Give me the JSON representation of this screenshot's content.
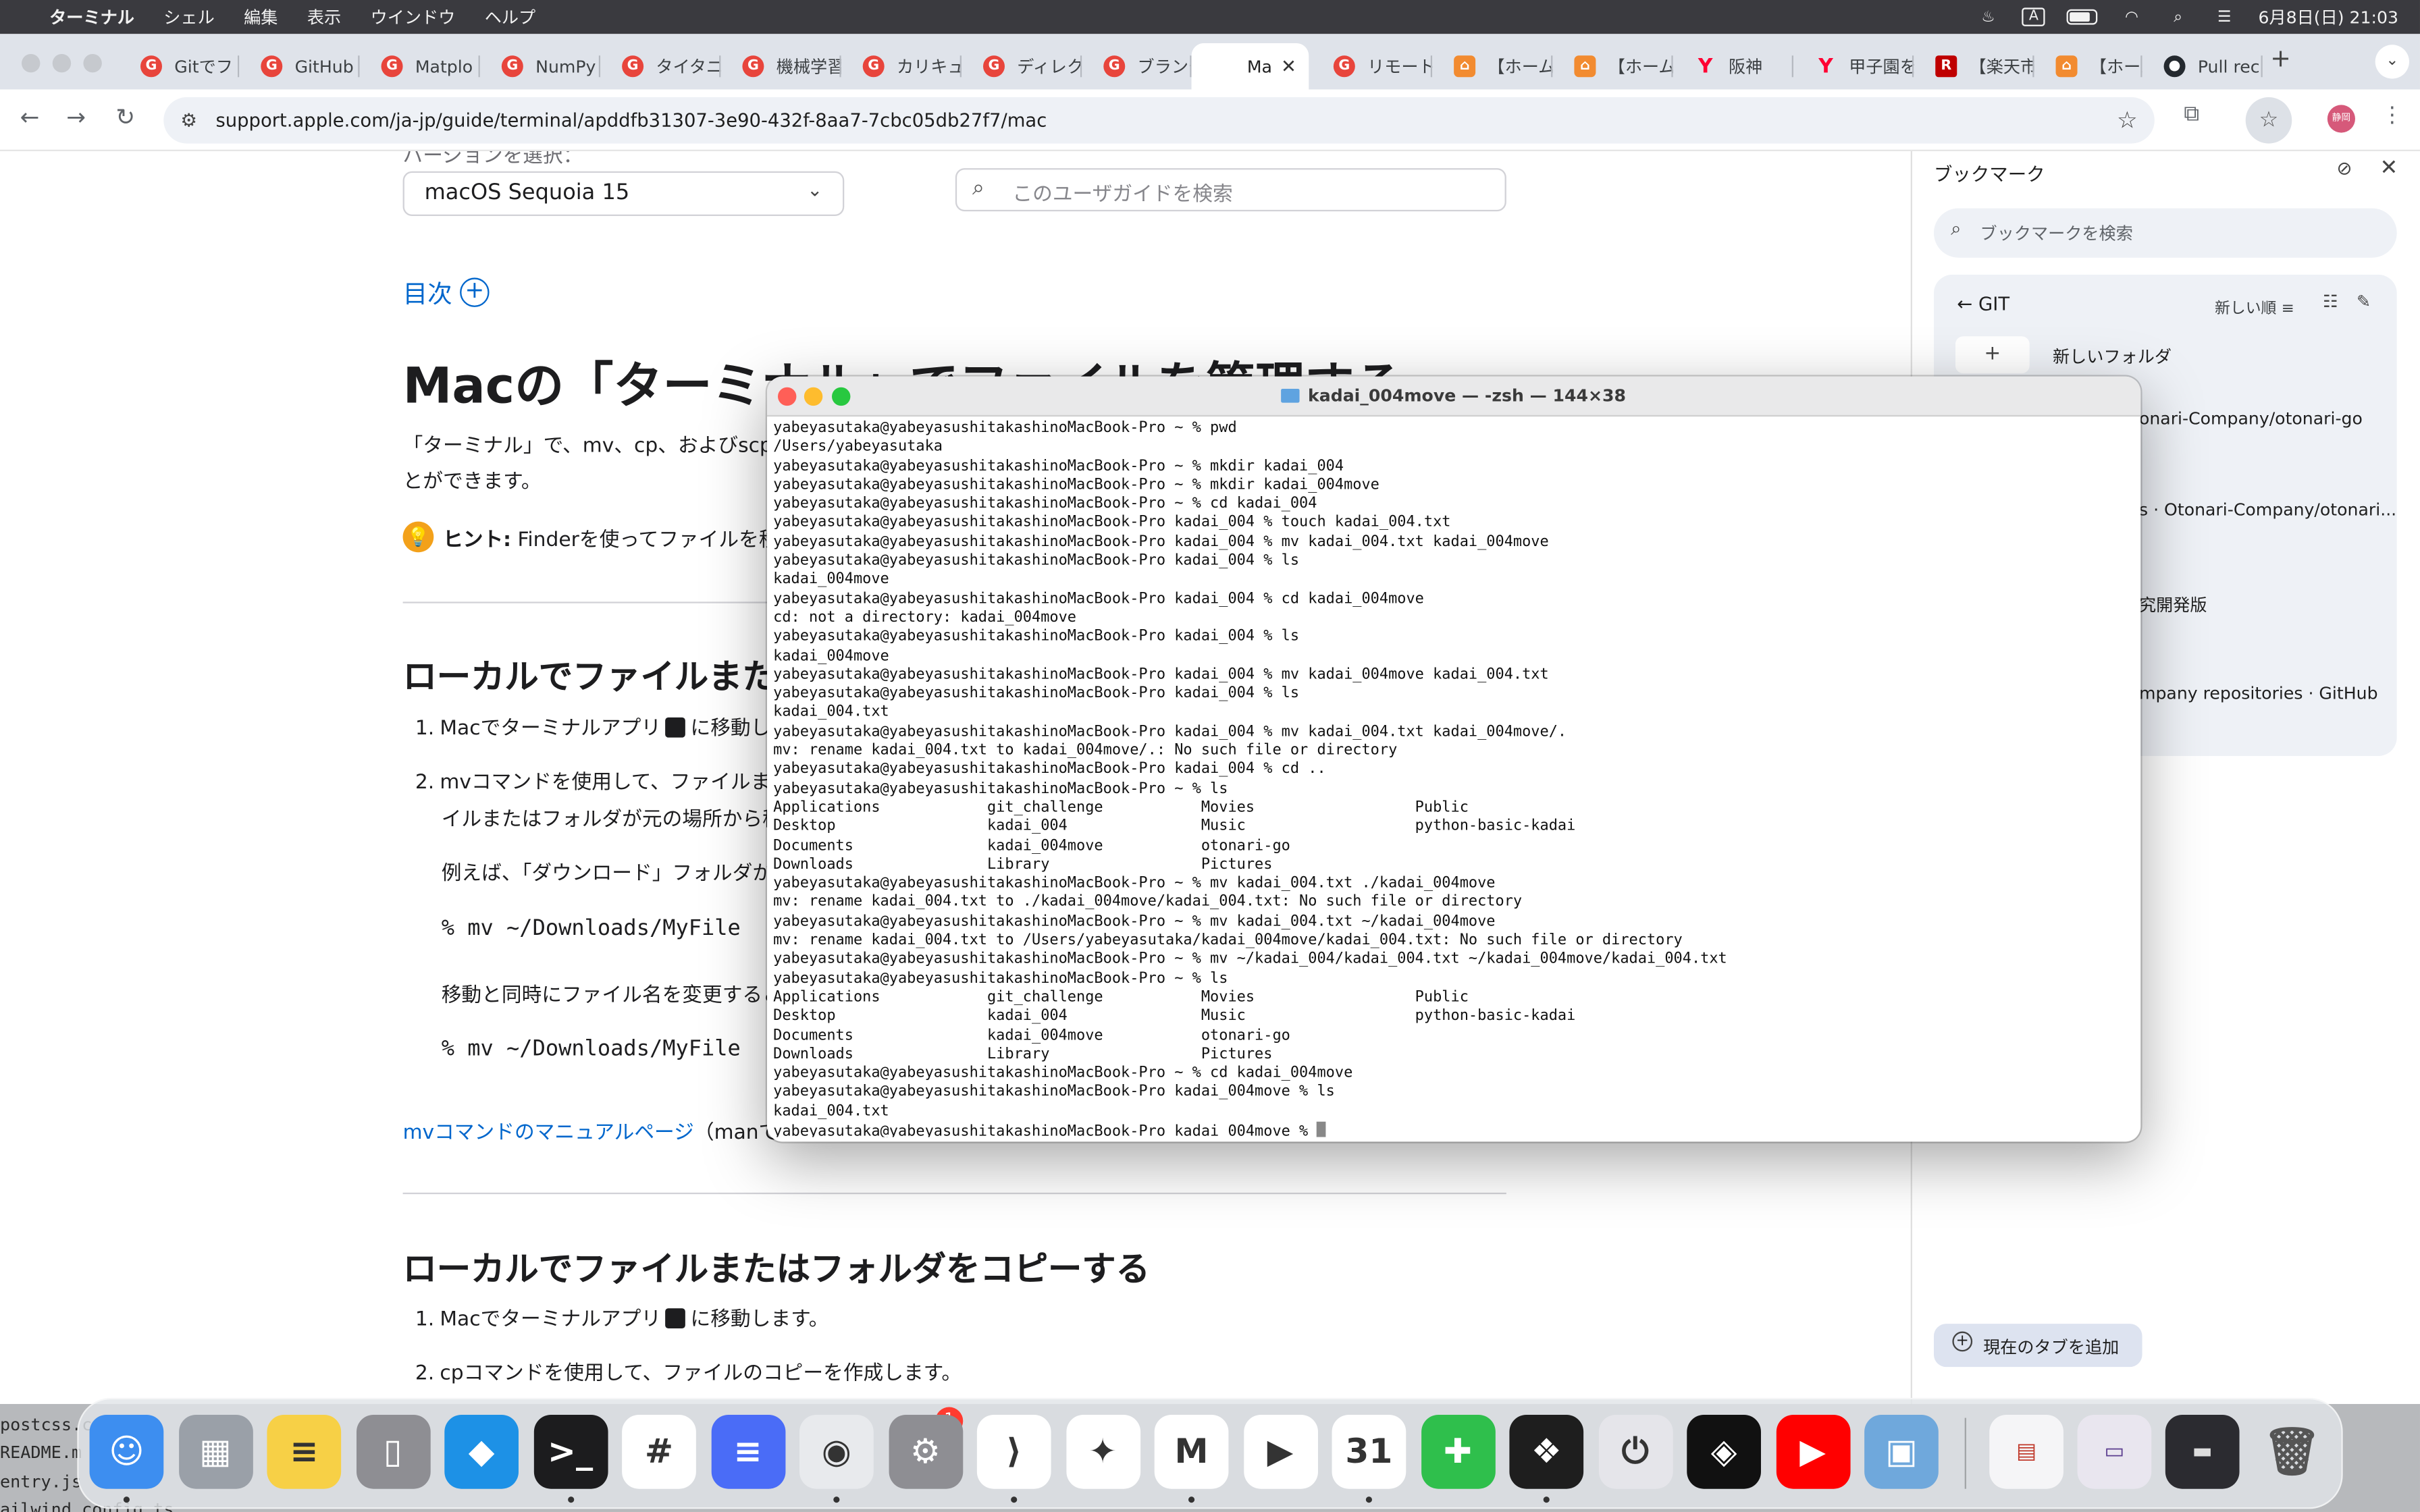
{
  "menubar": {
    "app_name": "ターミナル",
    "items": [
      "シェル",
      "編集",
      "表示",
      "ウインドウ",
      "ヘルプ"
    ],
    "input_indicator": "A",
    "clock": "6月8日(日) 21:03"
  },
  "tabs": [
    {
      "label": "Gitでフ",
      "icon": "red"
    },
    {
      "label": "GitHub",
      "icon": "red"
    },
    {
      "label": "Matplo",
      "icon": "red"
    },
    {
      "label": "NumPy",
      "icon": "red"
    },
    {
      "label": "タイタニ",
      "icon": "red"
    },
    {
      "label": "機械学習",
      "icon": "red"
    },
    {
      "label": "カリキュ",
      "icon": "red"
    },
    {
      "label": "ディレク",
      "icon": "red"
    },
    {
      "label": "ブランチ",
      "icon": "red"
    },
    {
      "label": "Ma",
      "icon": "apple",
      "active": true
    },
    {
      "label": "リモート",
      "icon": "red"
    },
    {
      "label": "【ホーム",
      "icon": "orange"
    },
    {
      "label": "【ホーム",
      "icon": "orange"
    },
    {
      "label": "阪神",
      "icon": "yahoo"
    },
    {
      "label": "甲子園を",
      "icon": "yahoo"
    },
    {
      "label": "【楽天市",
      "icon": "rakuten"
    },
    {
      "label": "【ホーム",
      "icon": "orange"
    },
    {
      "label": "Pull rec",
      "icon": "gh"
    }
  ],
  "address_bar": {
    "url": "support.apple.com/ja-jp/guide/terminal/apddfb31307-3e90-432f-8aa7-7cbc05db27f7/mac"
  },
  "profile": {
    "initials": "静岡"
  },
  "page": {
    "crop_label": "バージョンを選択：",
    "version_select": "macOS Sequoia 15",
    "search_placeholder": "このユーザガイドを検索",
    "toc_label": "目次",
    "title": "Macの「ターミナル」でファイルを管理する",
    "intro_line1": "「ターミナル」で、mv、cp、およびscpコマン",
    "intro_line2": "とができます。",
    "hint_label": "ヒント:",
    "hint_text": "Finderを使ってファイルを移動",
    "section1_heading": "ローカルでファイルまた",
    "step1_a": "Macでターミナルアプリ",
    "step1_b": "に移動しま",
    "step2_a": "mvコマンドを使用して、ファイルまたは",
    "step2_b": "イルまたはフォルダが元の場所から移",
    "example_text": "例えば、「ダウンロード」フォルダから「書",
    "code1": "% mv ~/Downloads/MyFile",
    "rename_text": "移動と同時にファイル名を変更すること",
    "code2": "% mv ~/Downloads/MyFile",
    "man_link": "mvコマンドのマニュアルページ",
    "man_rest": "（manで表示",
    "section2_heading": "ローカルでファイルまたはフォルダをコピーする",
    "copy_step1_a": "Macでターミナルアプリ",
    "copy_step1_b": "に移動します。",
    "copy_step2": "cpコマンドを使用して、ファイルのコピーを作成します。"
  },
  "bookmarks_panel": {
    "title": "ブックマーク",
    "search_placeholder": "ブックマークを検索",
    "folder": "GIT",
    "sort_label": "新しい順",
    "new_folder_label": "新しいフォルダ",
    "items": [
      "onari-Company/otonari-go",
      "s · Otonari-Company/otonari...",
      "究開発版",
      "mpany repositories · GitHub"
    ],
    "add_tab_label": "現在のタブを追加"
  },
  "terminal": {
    "title": "kadai_004move — -zsh — 144×38",
    "lines": [
      "yabeyasutaka@yabeyasushitakashinoMacBook-Pro ~ % pwd",
      "/Users/yabeyasutaka",
      "yabeyasutaka@yabeyasushitakashinoMacBook-Pro ~ % mkdir kadai_004",
      "yabeyasutaka@yabeyasushitakashinoMacBook-Pro ~ % mkdir kadai_004move",
      "yabeyasutaka@yabeyasushitakashinoMacBook-Pro ~ % cd kadai_004",
      "yabeyasutaka@yabeyasushitakashinoMacBook-Pro kadai_004 % touch kadai_004.txt",
      "yabeyasutaka@yabeyasushitakashinoMacBook-Pro kadai_004 % mv kadai_004.txt kadai_004move",
      "yabeyasutaka@yabeyasushitakashinoMacBook-Pro kadai_004 % ls",
      "kadai_004move",
      "yabeyasutaka@yabeyasushitakashinoMacBook-Pro kadai_004 % cd kadai_004move",
      "cd: not a directory: kadai_004move",
      "yabeyasutaka@yabeyasushitakashinoMacBook-Pro kadai_004 % ls",
      "kadai_004move",
      "yabeyasutaka@yabeyasushitakashinoMacBook-Pro kadai_004 % mv kadai_004move kadai_004.txt",
      "yabeyasutaka@yabeyasushitakashinoMacBook-Pro kadai_004 % ls",
      "kadai_004.txt",
      "yabeyasutaka@yabeyasushitakashinoMacBook-Pro kadai_004 % mv kadai_004.txt kadai_004move/.",
      "mv: rename kadai_004.txt to kadai_004move/.: No such file or directory",
      "yabeyasutaka@yabeyasushitakashinoMacBook-Pro kadai_004 % cd ..",
      "yabeyasutaka@yabeyasushitakashinoMacBook-Pro ~ % ls",
      "Applications            git_challenge           Movies                  Public",
      "Desktop                 kadai_004               Music                   python-basic-kadai",
      "Documents               kadai_004move           otonari-go",
      "Downloads               Library                 Pictures",
      "yabeyasutaka@yabeyasushitakashinoMacBook-Pro ~ % mv kadai_004.txt ./kadai_004move",
      "mv: rename kadai_004.txt to ./kadai_004move/kadai_004.txt: No such file or directory",
      "yabeyasutaka@yabeyasushitakashinoMacBook-Pro ~ % mv kadai_004.txt ~/kadai_004move",
      "mv: rename kadai_004.txt to /Users/yabeyasutaka/kadai_004move/kadai_004.txt: No such file or directory",
      "yabeyasutaka@yabeyasushitakashinoMacBook-Pro ~ % mv ~/kadai_004/kadai_004.txt ~/kadai_004move/kadai_004.txt",
      "yabeyasutaka@yabeyasushitakashinoMacBook-Pro ~ % ls",
      "Applications            git_challenge           Movies                  Public",
      "Desktop                 kadai_004               Music                   python-basic-kadai",
      "Documents               kadai_004move           otonari-go",
      "Downloads               Library                 Pictures",
      "yabeyasutaka@yabeyasushitakashinoMacBook-Pro ~ % cd kadai_004move",
      "yabeyasutaka@yabeyasushitakashinoMacBook-Pro kadai_004move % ls",
      "kadai_004.txt",
      "yabeyasutaka@yabeyasushitakashinoMacBook-Pro kadai_004move % "
    ]
  },
  "background_text": {
    "line1": "postcss.co",
    "line2": "README.m",
    "line3": "entry.js",
    "line4": "ailwind.config.ts"
  },
  "dock": {
    "apps": [
      {
        "name": "finder-icon",
        "color": "#3d8ef0",
        "glyph": "☺"
      },
      {
        "name": "launchpad-icon",
        "color": "#9aa0a8",
        "glyph": "▦"
      },
      {
        "name": "notes-icon",
        "color": "#f7d046",
        "glyph": "≡"
      },
      {
        "name": "iphone-mirroring-icon",
        "color": "#8e8e93",
        "glyph": "▯"
      },
      {
        "name": "docker-icon",
        "color": "#1d91e6",
        "glyph": "◆"
      },
      {
        "name": "terminal-icon",
        "color": "#1c1c1e",
        "glyph": ">_"
      },
      {
        "name": "slack-icon",
        "color": "#ffffff",
        "glyph": "#"
      },
      {
        "name": "docs-icon",
        "color": "#4a6cf7",
        "glyph": "≡"
      },
      {
        "name": "chrome-icon",
        "color": "#e8eaed",
        "glyph": "◉"
      },
      {
        "name": "system-settings-icon",
        "color": "#8e8e93",
        "glyph": "⚙"
      },
      {
        "name": "vscode-icon",
        "color": "#ffffff",
        "glyph": "⟩"
      },
      {
        "name": "gemini-icon",
        "color": "#ffffff",
        "glyph": "✦"
      },
      {
        "name": "gmail-icon",
        "color": "#ffffff",
        "glyph": "M"
      },
      {
        "name": "meet-icon",
        "color": "#ffffff",
        "glyph": "▶"
      },
      {
        "name": "calendar-icon",
        "color": "#ffffff",
        "glyph": "31"
      },
      {
        "name": "numbers-icon",
        "color": "#2fbf4c",
        "glyph": "✚"
      },
      {
        "name": "figma-icon",
        "color": "#1e1e1e",
        "glyph": "❖"
      },
      {
        "name": "power-icon",
        "color": "#e5e5ea",
        "glyph": "⏻"
      },
      {
        "name": "unity-icon",
        "color": "#111111",
        "glyph": "◈"
      },
      {
        "name": "youtube-icon",
        "color": "#ff0000",
        "glyph": "▶"
      },
      {
        "name": "preview-icon",
        "color": "#6fa8dc",
        "glyph": "▣"
      }
    ],
    "settings_badge": "1"
  }
}
